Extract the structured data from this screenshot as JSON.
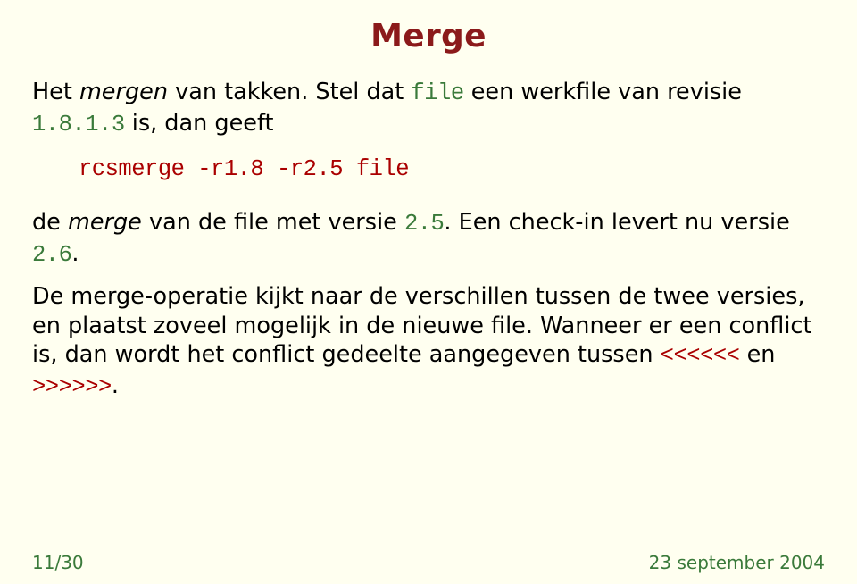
{
  "title": "Merge",
  "para1": {
    "s1": "Het ",
    "em1": "mergen",
    "s2": " van takken. Stel dat ",
    "code1": "file",
    "s3": " een werkfile van revisie ",
    "code2": "1.8.1.3",
    "s4": " is, dan geeft"
  },
  "cmd": "rcsmerge -r1.8 -r2.5 file",
  "para2": {
    "s1": "de ",
    "em1": "merge",
    "s2": " van de file met versie ",
    "code1": "2.5",
    "s3": ". Een check-in levert nu versie ",
    "code2": "2.6",
    "s4": "."
  },
  "para3": {
    "s1": "De merge-operatie kijkt naar de verschillen tussen de twee versies, en plaatst zoveel mogelijk in de nieuwe file. Wanneer er een conflict is, dan wordt het conflict gedeelte aangegeven tussen ",
    "code1": "<<<<<<",
    "s2": " en ",
    "code2": ">>>>>>",
    "s3": "."
  },
  "footer": {
    "page": "11/30",
    "date": "23 september 2004"
  }
}
